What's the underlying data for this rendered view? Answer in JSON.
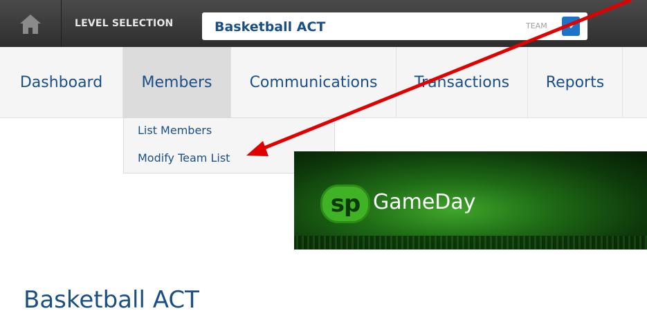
{
  "top_bar": {
    "level_label": "LEVEL SELECTION",
    "level_value": "Basketball ACT",
    "level_type": "TEAM"
  },
  "nav": {
    "tabs": [
      {
        "label": "Dashboard"
      },
      {
        "label": "Members",
        "active": true
      },
      {
        "label": "Communications"
      },
      {
        "label": "Transactions"
      },
      {
        "label": "Reports"
      }
    ]
  },
  "members_menu": {
    "items": [
      "List Members",
      "Modify Team List"
    ]
  },
  "banner": {
    "logo_text": "sp",
    "brand": "GameDay"
  },
  "main": {
    "org_title": "Basketball ACT"
  },
  "colors": {
    "brand_blue": "#1a4f86",
    "accent_blue": "#1d74c6",
    "annotation_red": "#e00000"
  },
  "icons": {
    "home": "home-icon",
    "dropdown": "chevron-down-icon"
  }
}
